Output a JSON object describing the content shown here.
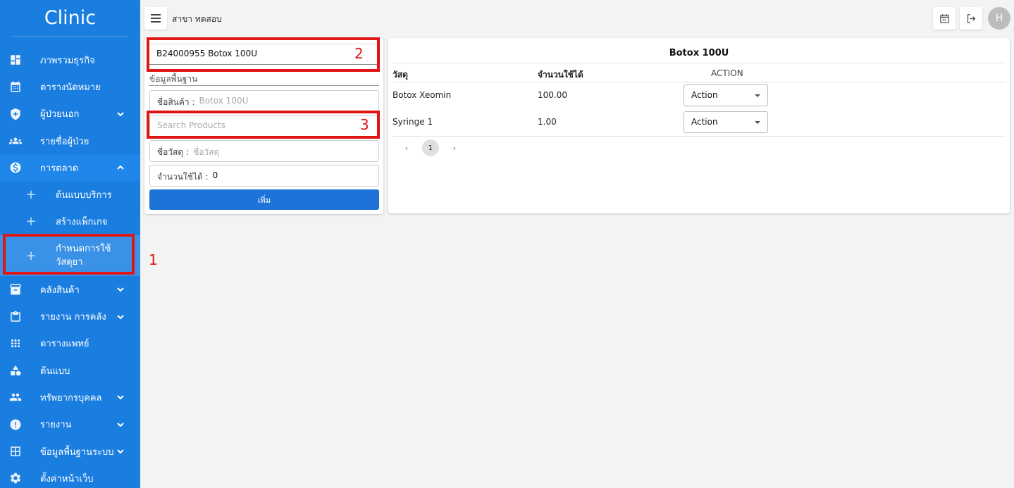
{
  "app": {
    "brand": "Clinic"
  },
  "sidebar": {
    "items": [
      {
        "label": "ภาพรวมธุรกิจ",
        "icon": "dashboard-icon",
        "has_chevron": false
      },
      {
        "label": "ตารางนัดหมาย",
        "icon": "calendar-icon",
        "has_chevron": false
      },
      {
        "label": "ผู้ป่วยนอก",
        "icon": "shield-icon",
        "has_chevron": true
      },
      {
        "label": "รายชื่อผู้ป่วย",
        "icon": "people-icon",
        "has_chevron": false
      },
      {
        "label": "การตลาด",
        "icon": "dollar-icon",
        "has_chevron": true,
        "expanded": true
      },
      {
        "label": "คลังสินค้า",
        "icon": "archive-icon",
        "has_chevron": true
      },
      {
        "label": "รายงาน การคลัง",
        "icon": "clipboard-icon",
        "has_chevron": true
      },
      {
        "label": "ตารางแพทย์",
        "icon": "doctors-icon",
        "has_chevron": false
      },
      {
        "label": "ต้นแบบ",
        "icon": "shapes-icon",
        "has_chevron": false
      },
      {
        "label": "ทรัพยากรบุคคล",
        "icon": "group-icon",
        "has_chevron": true
      },
      {
        "label": "รายงาน",
        "icon": "alert-icon",
        "has_chevron": true
      },
      {
        "label": "ข้อมูลพื้นฐานระบบ",
        "icon": "grid-icon",
        "has_chevron": true
      },
      {
        "label": "ตั้งค่าหน้าเว็บ",
        "icon": "gear-icon",
        "has_chevron": false
      }
    ],
    "subitems": [
      {
        "label": "ต้นแบบบริการ"
      },
      {
        "label": "สร้างแพ็กเกจ"
      },
      {
        "label": "กำหนดการใช้วัสดุยา",
        "active": true
      }
    ]
  },
  "topbar": {
    "branch": "สาขา ทดสอบ",
    "avatar_initial": "H"
  },
  "form": {
    "product_selected": "B24000955 Botox 100U",
    "section_label": "ข้อมูลพื้นฐาน",
    "product_name_label": "ชื่อสินค้า :",
    "product_name_value": "Botox 100U",
    "search_placeholder": "Search Products",
    "material_label": "ชื่อวัสดุ :",
    "material_placeholder": "ชื่อวัสดุ",
    "quantity_label": "จำนวนใช้ได้ :",
    "quantity_value": "0",
    "add_button": "เพิ่ม"
  },
  "table": {
    "title": "Botox 100U",
    "headers": {
      "material": "วัสดุ",
      "quantity": "จำนวนใช้ได้",
      "action": "ACTION"
    },
    "rows": [
      {
        "material": "Botox Xeomin",
        "quantity": "100.00",
        "action": "Action"
      },
      {
        "material": "Syringe 1",
        "quantity": "1.00",
        "action": "Action"
      }
    ],
    "current_page": "1"
  },
  "annotations": {
    "n1": "1",
    "n2": "2",
    "n3": "3"
  },
  "colors": {
    "sidebar": "#1a7de0",
    "primary_button": "#1e73d8",
    "annotation": "#e01515"
  }
}
